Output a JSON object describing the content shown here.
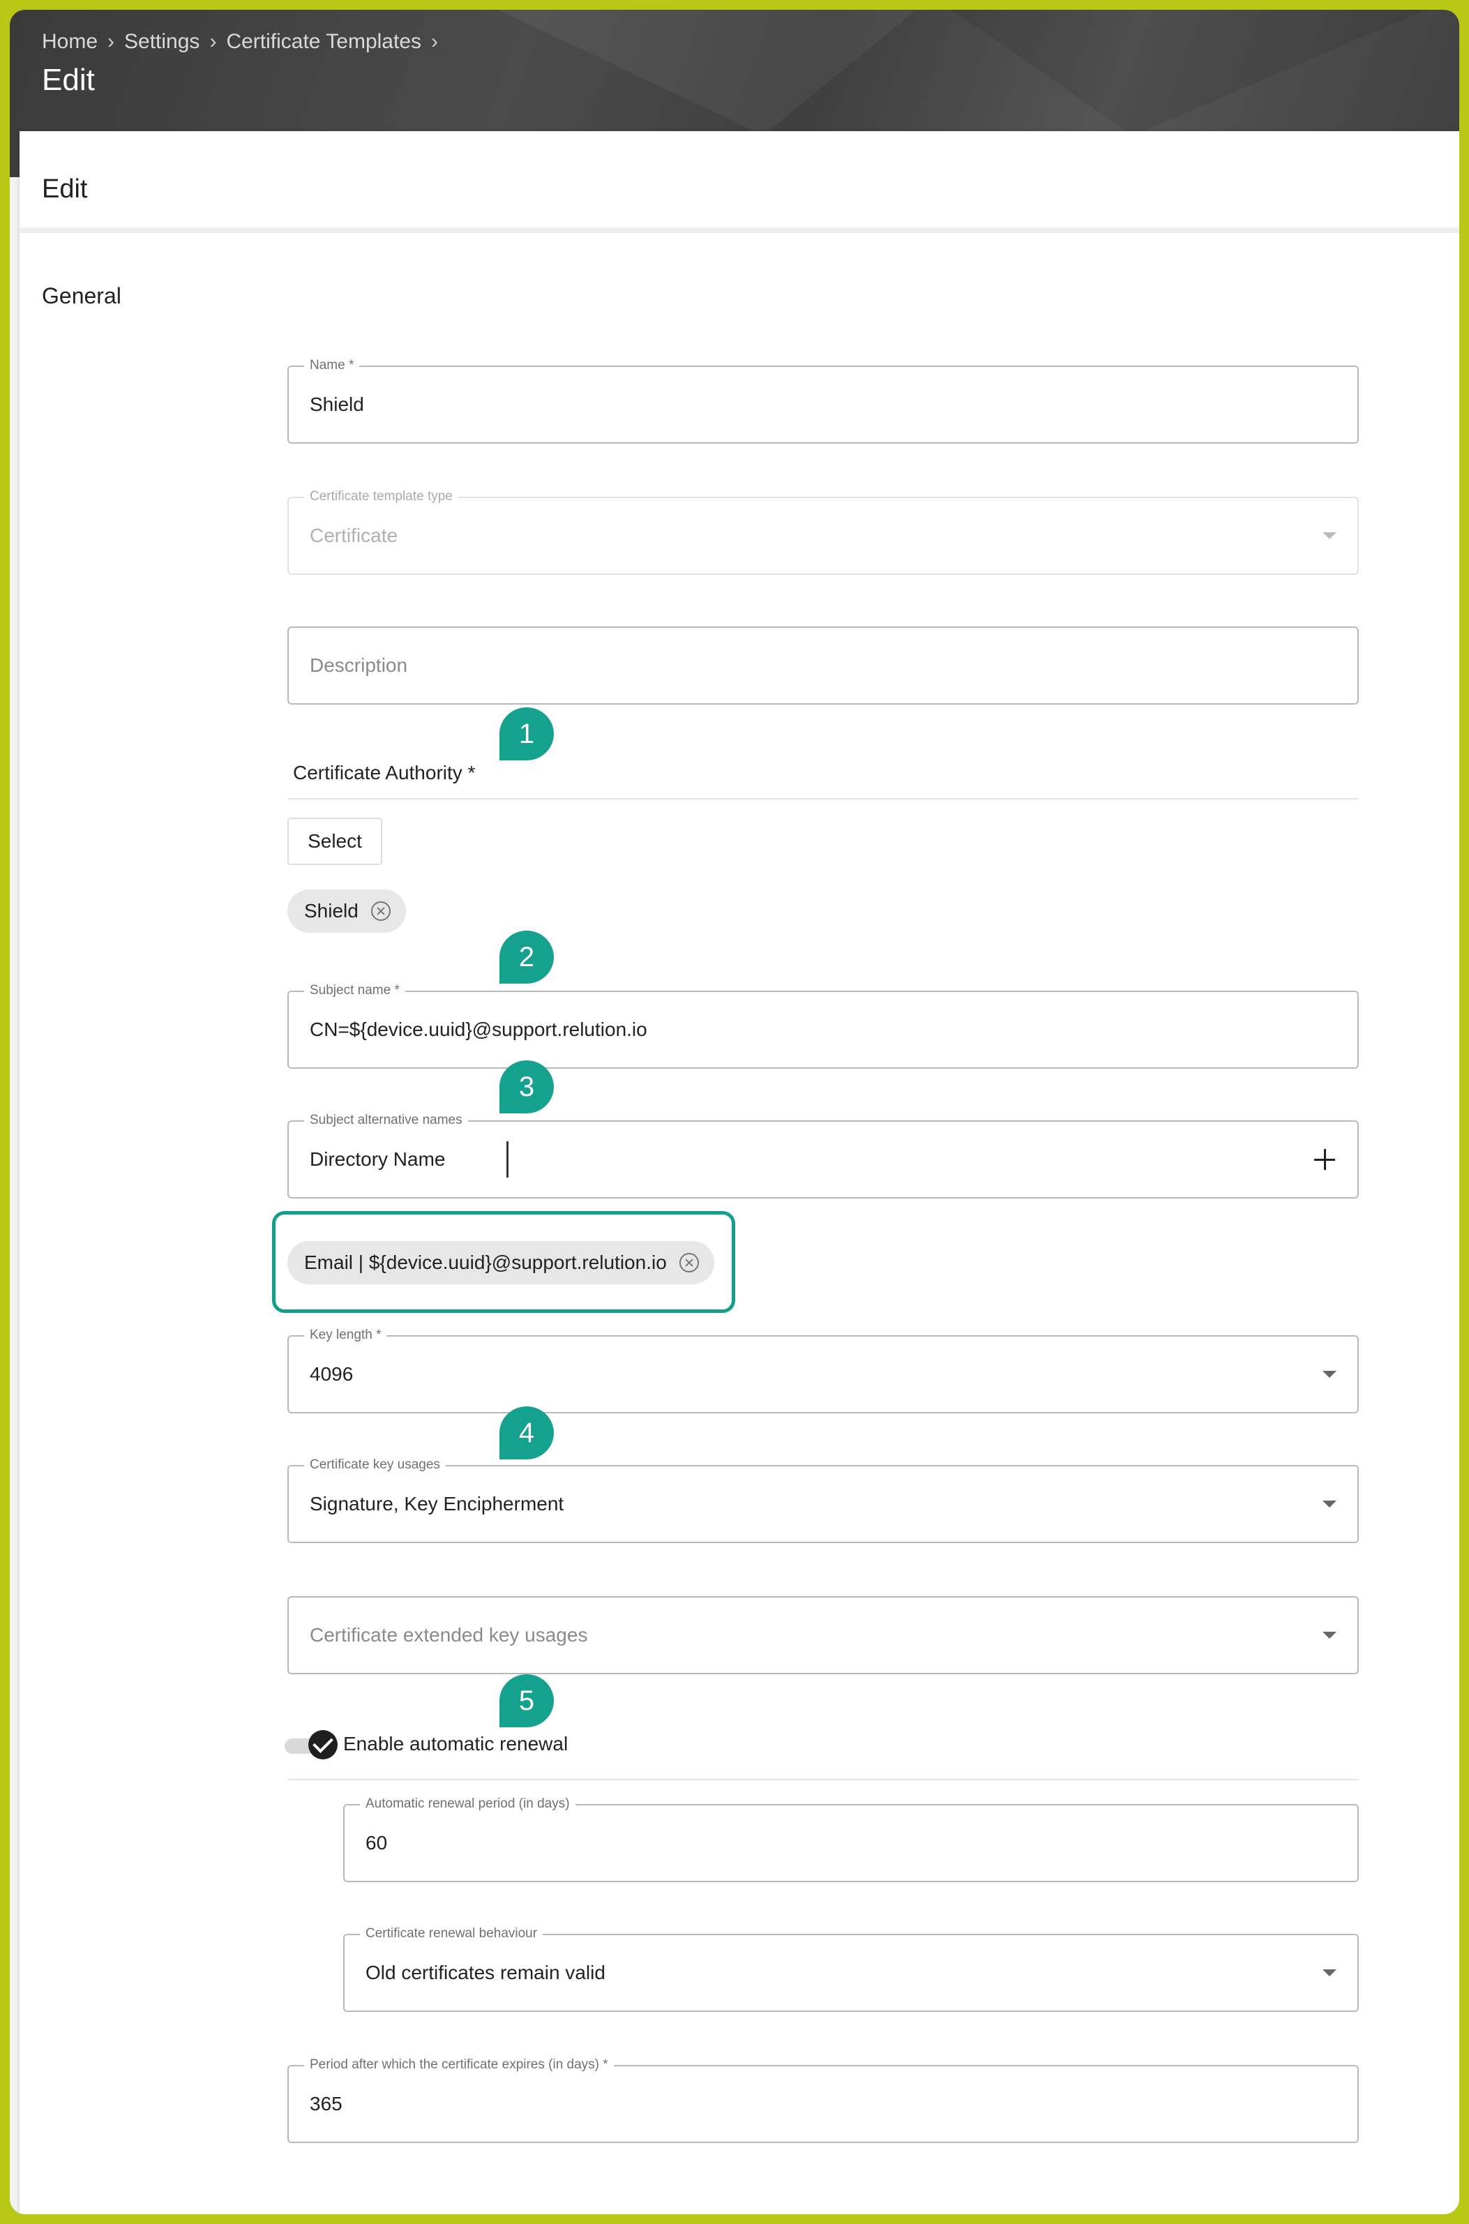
{
  "breadcrumb": {
    "items": [
      "Home",
      "Settings",
      "Certificate Templates"
    ]
  },
  "header": {
    "title": "Edit"
  },
  "card": {
    "title": "Edit",
    "section": "General"
  },
  "form": {
    "name": {
      "label": "Name *",
      "value": "Shield"
    },
    "template_type": {
      "label": "Certificate template type",
      "value": "Certificate"
    },
    "description": {
      "placeholder": "Description"
    },
    "certificate_authority": {
      "label": "Certificate Authority *",
      "select_label": "Select",
      "chip": "Shield"
    },
    "subject_name": {
      "label": "Subject name *",
      "value": "CN=${device.uuid}@support.relution.io"
    },
    "subject_alt_names": {
      "label": "Subject alternative names",
      "value": "Directory Name",
      "chip": "Email | ${device.uuid}@support.relution.io"
    },
    "key_length": {
      "label": "Key length *",
      "value": "4096"
    },
    "key_usages": {
      "label": "Certificate key usages",
      "value": "Signature, Key Encipherment"
    },
    "extended_key_usages": {
      "placeholder": "Certificate extended key usages"
    },
    "auto_renewal": {
      "label": "Enable automatic renewal"
    },
    "renewal_period": {
      "label": "Automatic renewal period (in days)",
      "value": "60"
    },
    "renewal_behaviour": {
      "label": "Certificate renewal behaviour",
      "value": "Old certificates remain valid"
    },
    "expiry_period": {
      "label": "Period after which the certificate expires (in days) *",
      "value": "365"
    }
  },
  "markers": [
    "1",
    "2",
    "3",
    "4",
    "5"
  ],
  "colors": {
    "accent": "#14a18e",
    "border": "#b8c814",
    "header": "#3f3f3f"
  },
  "icons": {
    "breadcrumb_separator": "chevron-right-icon",
    "dropdown": "caret-down-icon",
    "add": "plus-icon",
    "chip_remove": "close-circle-icon",
    "toggle": "check-icon"
  }
}
